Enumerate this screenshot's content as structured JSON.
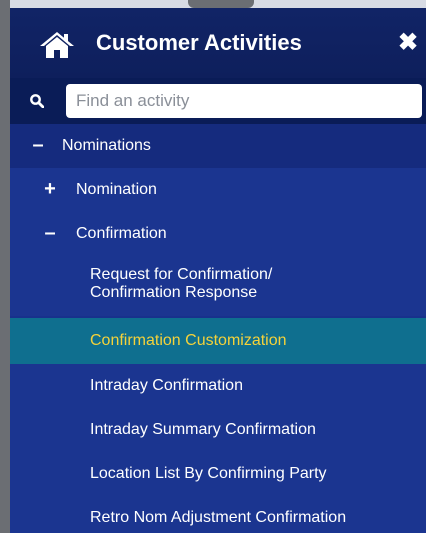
{
  "header": {
    "title": "Customer Activities",
    "close_glyph": "✖",
    "home_icon": "home-icon"
  },
  "search": {
    "placeholder": "Find an activity",
    "value": "",
    "icon": "search-icon"
  },
  "menu": {
    "nominations": {
      "toggle": "–",
      "label": "Nominations"
    },
    "nomination": {
      "toggle": "+",
      "label": "Nomination"
    },
    "confirmation": {
      "toggle": "–",
      "label": "Confirmation"
    },
    "items": [
      {
        "line1": "Request for Confirmation/",
        "line2": "Confirmation Response"
      },
      {
        "label": "Confirmation Customization"
      },
      {
        "label": "Intraday Confirmation"
      },
      {
        "label": "Intraday Summary Confirmation"
      },
      {
        "label": "Location List By Confirming Party"
      },
      {
        "label": "Retro Nom Adjustment Confirmation"
      }
    ]
  },
  "colors": {
    "panel_bg": "#18318c",
    "header_bg": "#0e1f5c",
    "search_bg": "#0a1c57",
    "active_bg": "#0f6f8f",
    "active_text": "#f4d23a"
  }
}
